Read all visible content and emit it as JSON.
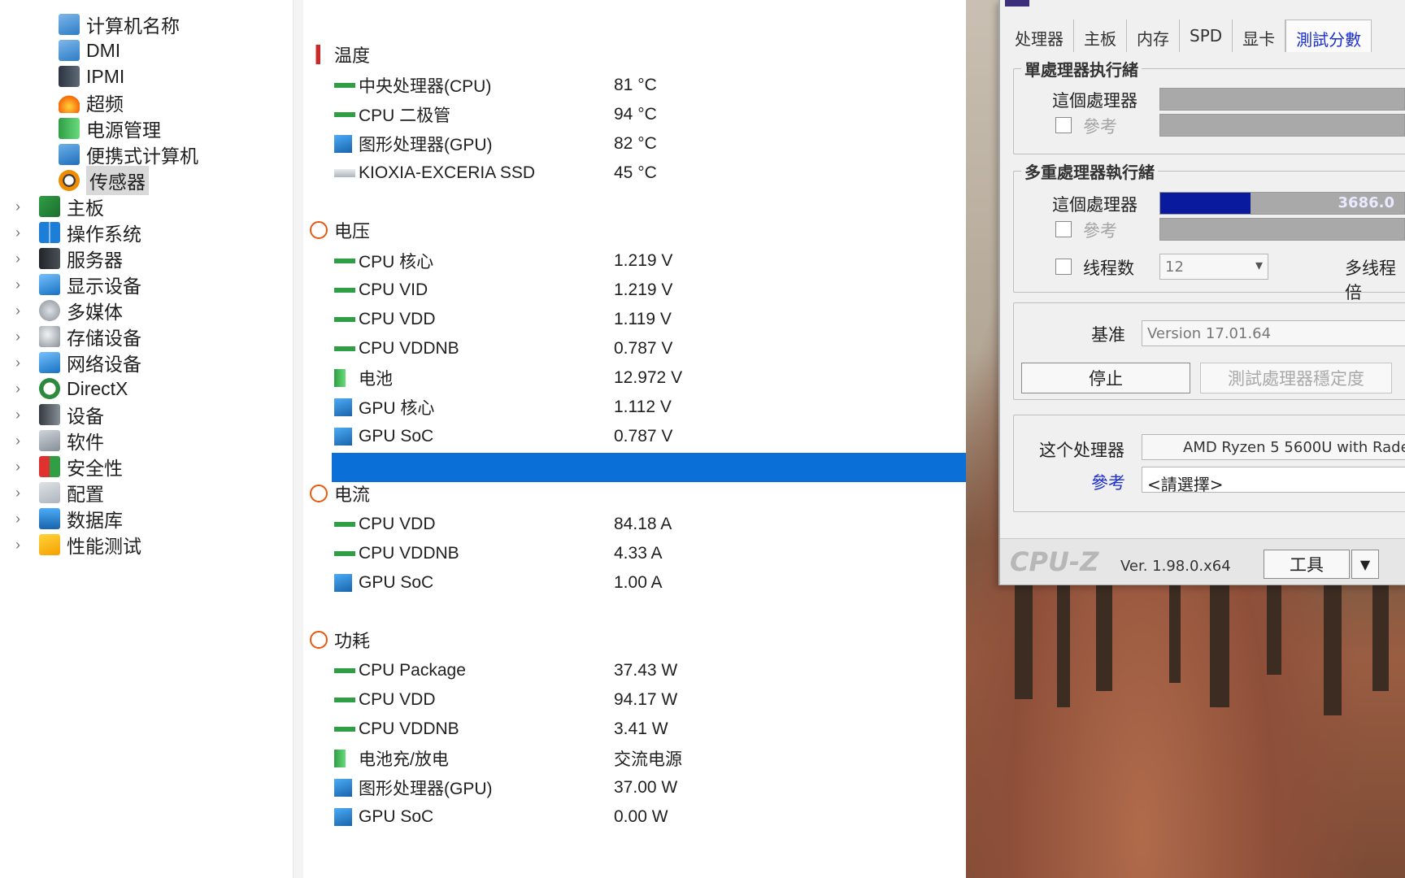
{
  "tree": {
    "items": [
      {
        "label": "计算机名称",
        "icon": "computer-icon"
      },
      {
        "label": "DMI",
        "icon": "dmi-icon"
      },
      {
        "label": "IPMI",
        "icon": "ipmi-icon"
      },
      {
        "label": "超频",
        "icon": "flame-icon"
      },
      {
        "label": "电源管理",
        "icon": "battery-icon"
      },
      {
        "label": "便携式计算机",
        "icon": "laptop-icon"
      },
      {
        "label": "传感器",
        "icon": "sensor-icon"
      },
      {
        "label": "主板",
        "icon": "motherboard-icon"
      },
      {
        "label": "操作系统",
        "icon": "windows-icon"
      },
      {
        "label": "服务器",
        "icon": "server-icon"
      },
      {
        "label": "显示设备",
        "icon": "display-icon"
      },
      {
        "label": "多媒体",
        "icon": "multimedia-icon"
      },
      {
        "label": "存储设备",
        "icon": "storage-icon"
      },
      {
        "label": "网络设备",
        "icon": "network-icon"
      },
      {
        "label": "DirectX",
        "icon": "xbox-icon"
      },
      {
        "label": "设备",
        "icon": "device-icon"
      },
      {
        "label": "软件",
        "icon": "software-icon"
      },
      {
        "label": "安全性",
        "icon": "shield-icon"
      },
      {
        "label": "配置",
        "icon": "config-icon"
      },
      {
        "label": "数据库",
        "icon": "database-icon"
      },
      {
        "label": "性能测试",
        "icon": "benchmark-icon"
      }
    ]
  },
  "sensors": {
    "temperature": {
      "title": "温度",
      "rows": [
        {
          "label": "中央处理器(CPU)",
          "value": "81 °C"
        },
        {
          "label": "CPU 二极管",
          "value": "94 °C"
        },
        {
          "label": "图形处理器(GPU)",
          "value": "82 °C"
        },
        {
          "label": "KIOXIA-EXCERIA SSD",
          "value": "45 °C"
        }
      ]
    },
    "voltage": {
      "title": "电压",
      "rows": [
        {
          "label": "CPU 核心",
          "value": "1.219 V"
        },
        {
          "label": "CPU VID",
          "value": "1.219 V"
        },
        {
          "label": "CPU VDD",
          "value": "1.119 V"
        },
        {
          "label": "CPU VDDNB",
          "value": "0.787 V"
        },
        {
          "label": "电池",
          "value": "12.972 V"
        },
        {
          "label": "GPU 核心",
          "value": "1.112 V"
        },
        {
          "label": "GPU SoC",
          "value": "0.787 V"
        }
      ]
    },
    "current": {
      "title": "电流",
      "rows": [
        {
          "label": "CPU VDD",
          "value": "84.18 A"
        },
        {
          "label": "CPU VDDNB",
          "value": "4.33 A"
        },
        {
          "label": "GPU SoC",
          "value": "1.00 A"
        }
      ]
    },
    "power": {
      "title": "功耗",
      "rows": [
        {
          "label": "CPU Package",
          "value": "37.43 W"
        },
        {
          "label": "CPU VDD",
          "value": "94.17 W"
        },
        {
          "label": "CPU VDDNB",
          "value": "3.41 W"
        },
        {
          "label": "电池充/放电",
          "value": "交流电源"
        },
        {
          "label": "图形处理器(GPU)",
          "value": "37.00 W"
        },
        {
          "label": "GPU SoC",
          "value": "0.00 W"
        }
      ]
    }
  },
  "cpuz": {
    "tabs": [
      "处理器",
      "主板",
      "内存",
      "SPD",
      "显卡",
      "測試分數"
    ],
    "single": {
      "title": "單處理器执行緒",
      "this_label": "這個處理器",
      "ref_label": "參考"
    },
    "multi": {
      "title": "多重處理器執行緒",
      "this_label": "這個處理器",
      "score": "3686.0",
      "score_fraction": 0.37,
      "ref_label": "參考",
      "threads_label": "线程数",
      "threads_value": "12",
      "multi_label": "多线程倍"
    },
    "baseline_label": "基准",
    "baseline_value": "Version 17.01.64",
    "stop_button": "停止",
    "stability_button": "測試處理器穩定度",
    "this_cpu_label": "这个处理器",
    "this_cpu_value": "AMD Ryzen 5 5600U with Rade",
    "reference_label": "參考",
    "reference_value": "<請選擇>",
    "brand": "CPU-Z",
    "version": "Ver. 1.98.0.x64",
    "tools_button": "工具"
  }
}
